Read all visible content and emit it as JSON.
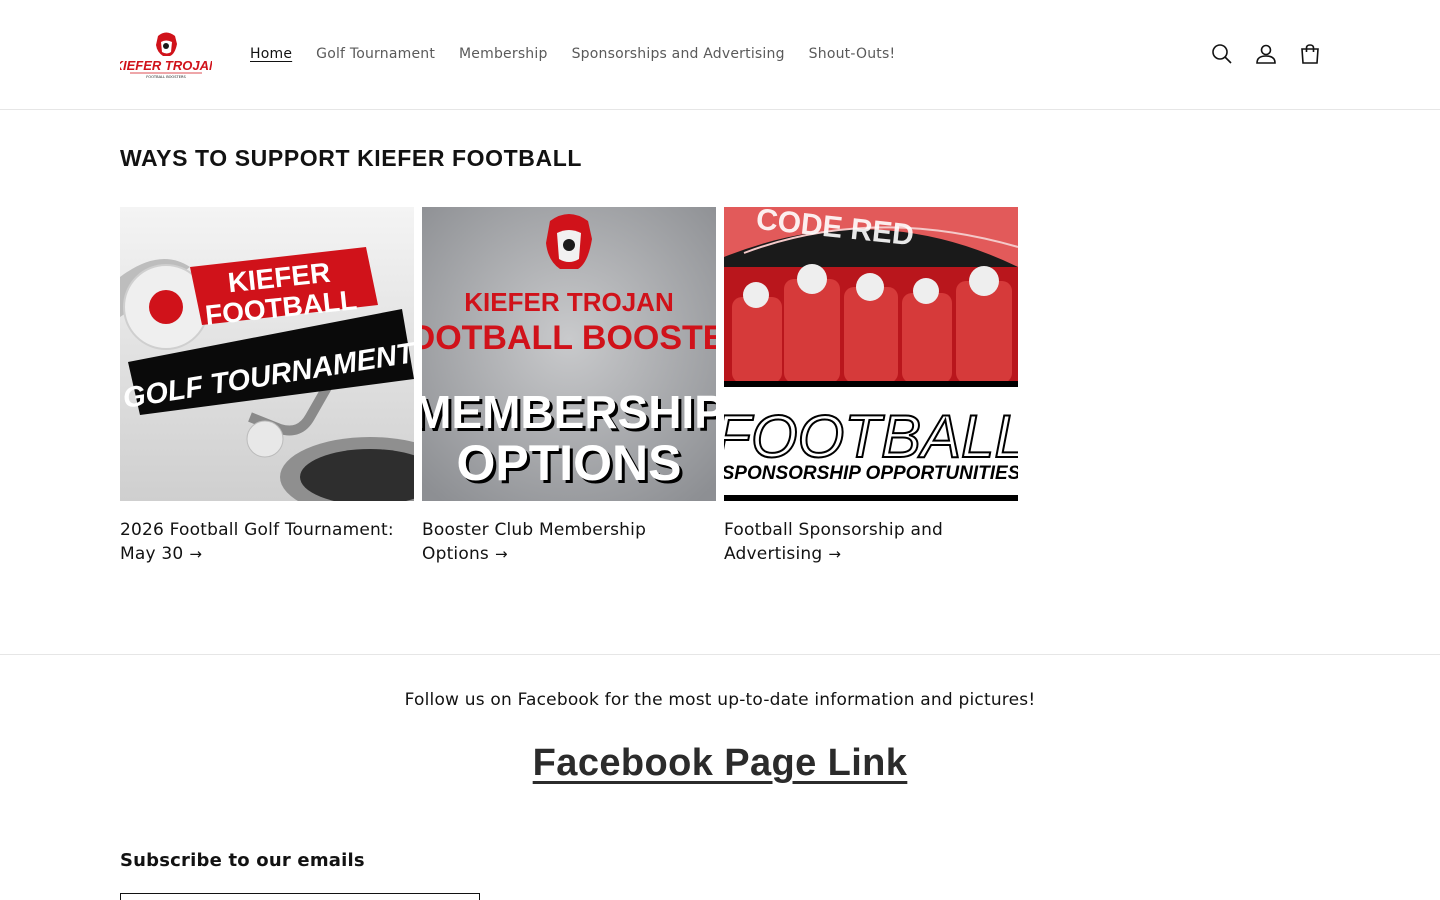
{
  "header": {
    "logo": {
      "text": "KIEFER TROJAN",
      "subtext": "FOOTBALL BOOSTERS"
    },
    "nav": [
      {
        "label": "Home",
        "active": true
      },
      {
        "label": "Golf Tournament"
      },
      {
        "label": "Membership"
      },
      {
        "label": "Sponsorships and Advertising"
      },
      {
        "label": "Shout-Outs!"
      }
    ],
    "icons": [
      "search-icon",
      "account-icon",
      "cart-icon"
    ]
  },
  "main": {
    "section_title": "WAYS TO SUPPORT KIEFER FOOTBALL",
    "cards": [
      {
        "title": "2026 Football Golf Tournament: May 30",
        "image": {
          "line1": "KIEFER",
          "line2": "FOOTBALL",
          "line3": "GOLF TOURNAMENT"
        }
      },
      {
        "title": "Booster Club Membership Options",
        "image": {
          "line1": "KIEFER TROJAN",
          "line2": "FOOTBALL BOOSTER",
          "line3": "MEMBERSHIP",
          "line4": "OPTIONS"
        }
      },
      {
        "title": "Football Sponsorship and Advertising",
        "image": {
          "banner": "CODE RED",
          "line1": "FOOTBALL",
          "line2": "SPONSORSHIP OPPORTUNITIES"
        }
      }
    ],
    "arrow": "→"
  },
  "footer": {
    "follow_text": "Follow us on Facebook for the most up-to-date information and pictures!",
    "facebook_link": "Facebook Page Link",
    "subscribe_title": "Subscribe to our emails"
  },
  "colors": {
    "brand_red": "#d0121a",
    "text": "#121212",
    "nav_text": "#5a5a5a",
    "border": "#e6e6e6"
  }
}
